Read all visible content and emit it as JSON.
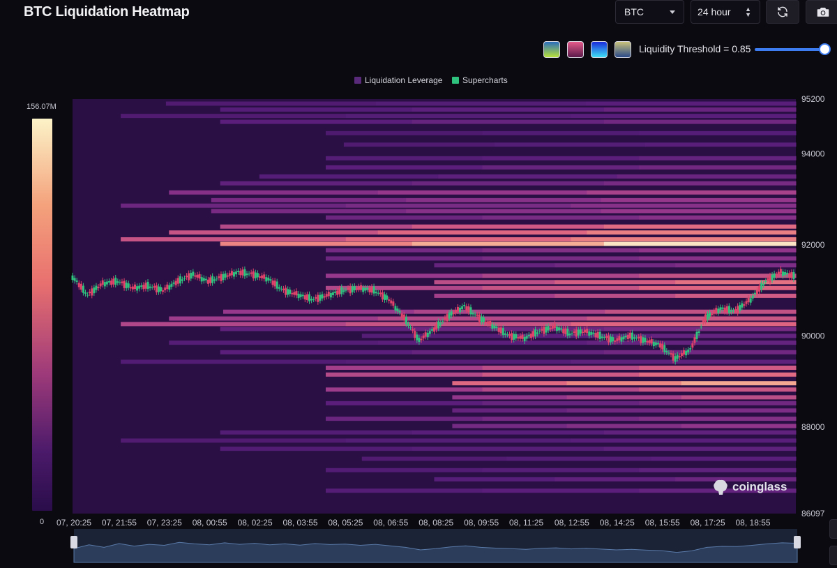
{
  "header": {
    "title": "BTC Liquidation Heatmap",
    "symbol_select": {
      "value": "BTC"
    },
    "time_select": {
      "value": "24 hour"
    }
  },
  "threshold": {
    "label": "Liquidity Threshold = 0.85",
    "value": 0.85,
    "palettes": [
      {
        "name": "viridis",
        "from": "#2b6dbb",
        "to": "#b8e23a"
      },
      {
        "name": "magma",
        "from": "#e35a8a",
        "to": "#5a1a4a"
      },
      {
        "name": "blue-cyan",
        "from": "#1a2ad8",
        "to": "#3fe0f5"
      },
      {
        "name": "cividis",
        "from": "#c9c27a",
        "to": "#2a4a8a"
      }
    ]
  },
  "legend": {
    "items": [
      {
        "label": "Liquidation Leverage",
        "color": "#5a2a7a"
      },
      {
        "label": "Supercharts",
        "color": "#2ec27e"
      }
    ]
  },
  "color_scale": {
    "max_label": "156.07M",
    "min_label": "0"
  },
  "brand": {
    "text": "coinglass"
  },
  "chart_data": {
    "type": "heatmap",
    "title": "BTC Liquidation Heatmap",
    "ylim": [
      86097,
      95200
    ],
    "y_ticks": [
      95200,
      94000,
      92000,
      90000,
      88000,
      86097
    ],
    "x_ticks": [
      "07, 20:25",
      "07, 21:55",
      "07, 23:25",
      "08, 00:55",
      "08, 02:25",
      "08, 03:55",
      "08, 05:25",
      "08, 06:55",
      "08, 08:25",
      "08, 09:55",
      "08, 11:25",
      "08, 12:55",
      "08, 14:25",
      "08, 15:55",
      "08, 17:25",
      "08, 18:55"
    ],
    "x_range_hours": [
      0,
      24
    ],
    "bands": [
      {
        "price": 95100,
        "start": 3.1,
        "intensity": 0.3
      },
      {
        "price": 94970,
        "start": 4.9,
        "intensity": 0.35
      },
      {
        "price": 94830,
        "start": 1.6,
        "intensity": 0.3
      },
      {
        "price": 94700,
        "start": 4.9,
        "intensity": 0.38
      },
      {
        "price": 94450,
        "start": 8.4,
        "intensity": 0.28
      },
      {
        "price": 94200,
        "start": 9.0,
        "intensity": 0.3
      },
      {
        "price": 93900,
        "start": 8.4,
        "intensity": 0.34
      },
      {
        "price": 93700,
        "start": 8.4,
        "intensity": 0.38
      },
      {
        "price": 93500,
        "start": 6.2,
        "intensity": 0.35
      },
      {
        "price": 93350,
        "start": 4.9,
        "intensity": 0.4
      },
      {
        "price": 93150,
        "start": 3.2,
        "intensity": 0.55
      },
      {
        "price": 92980,
        "start": 4.6,
        "intensity": 0.5
      },
      {
        "price": 92860,
        "start": 1.6,
        "intensity": 0.45
      },
      {
        "price": 92740,
        "start": 4.6,
        "intensity": 0.5
      },
      {
        "price": 92600,
        "start": 8.4,
        "intensity": 0.45
      },
      {
        "price": 92400,
        "start": 4.9,
        "intensity": 0.72
      },
      {
        "price": 92270,
        "start": 3.2,
        "intensity": 0.78
      },
      {
        "price": 92120,
        "start": 1.6,
        "intensity": 0.78
      },
      {
        "price": 92020,
        "start": 4.9,
        "intensity": 0.98
      },
      {
        "price": 91880,
        "start": 8.4,
        "intensity": 0.48
      },
      {
        "price": 91700,
        "start": 8.4,
        "intensity": 0.45
      },
      {
        "price": 91550,
        "start": 12.0,
        "intensity": 0.42
      },
      {
        "price": 91320,
        "start": 8.4,
        "intensity": 0.62
      },
      {
        "price": 91180,
        "start": 12.0,
        "intensity": 0.74
      },
      {
        "price": 91050,
        "start": 8.4,
        "intensity": 0.7
      },
      {
        "price": 90880,
        "start": 12.0,
        "intensity": 0.66
      },
      {
        "price": 90530,
        "start": 5.0,
        "intensity": 0.62
      },
      {
        "price": 90380,
        "start": 3.2,
        "intensity": 0.64
      },
      {
        "price": 90260,
        "start": 1.6,
        "intensity": 0.7
      },
      {
        "price": 90150,
        "start": 4.9,
        "intensity": 0.4
      },
      {
        "price": 90000,
        "start": 9.6,
        "intensity": 0.34
      },
      {
        "price": 89850,
        "start": 3.2,
        "intensity": 0.34
      },
      {
        "price": 89640,
        "start": 4.9,
        "intensity": 0.38
      },
      {
        "price": 89430,
        "start": 1.6,
        "intensity": 0.32
      },
      {
        "price": 89300,
        "start": 8.4,
        "intensity": 0.66
      },
      {
        "price": 89150,
        "start": 8.4,
        "intensity": 0.72
      },
      {
        "price": 88960,
        "start": 12.6,
        "intensity": 0.88
      },
      {
        "price": 88820,
        "start": 8.4,
        "intensity": 0.64
      },
      {
        "price": 88650,
        "start": 12.6,
        "intensity": 0.6
      },
      {
        "price": 88520,
        "start": 8.4,
        "intensity": 0.38
      },
      {
        "price": 88360,
        "start": 12.6,
        "intensity": 0.42
      },
      {
        "price": 88180,
        "start": 8.4,
        "intensity": 0.44
      },
      {
        "price": 88020,
        "start": 12.6,
        "intensity": 0.48
      },
      {
        "price": 87880,
        "start": 4.9,
        "intensity": 0.33
      },
      {
        "price": 87700,
        "start": 1.6,
        "intensity": 0.3
      },
      {
        "price": 87520,
        "start": 4.9,
        "intensity": 0.32
      },
      {
        "price": 87300,
        "start": 9.6,
        "intensity": 0.3
      },
      {
        "price": 87050,
        "start": 8.4,
        "intensity": 0.32
      },
      {
        "price": 86850,
        "start": 12.0,
        "intensity": 0.36
      },
      {
        "price": 86600,
        "start": 8.4,
        "intensity": 0.34
      }
    ],
    "price_series": [
      {
        "t": 0.0,
        "p": 91300
      },
      {
        "t": 0.5,
        "p": 90900
      },
      {
        "t": 1.0,
        "p": 91150
      },
      {
        "t": 1.5,
        "p": 91200
      },
      {
        "t": 2.0,
        "p": 91050
      },
      {
        "t": 2.5,
        "p": 91100
      },
      {
        "t": 3.0,
        "p": 91000
      },
      {
        "t": 3.5,
        "p": 91200
      },
      {
        "t": 4.0,
        "p": 91350
      },
      {
        "t": 4.5,
        "p": 91200
      },
      {
        "t": 5.0,
        "p": 91300
      },
      {
        "t": 5.5,
        "p": 91400
      },
      {
        "t": 6.0,
        "p": 91350
      },
      {
        "t": 6.5,
        "p": 91250
      },
      {
        "t": 7.0,
        "p": 91000
      },
      {
        "t": 7.5,
        "p": 90900
      },
      {
        "t": 8.0,
        "p": 90800
      },
      {
        "t": 8.5,
        "p": 90900
      },
      {
        "t": 9.0,
        "p": 91000
      },
      {
        "t": 9.5,
        "p": 91050
      },
      {
        "t": 10.0,
        "p": 91000
      },
      {
        "t": 10.5,
        "p": 90800
      },
      {
        "t": 11.0,
        "p": 90400
      },
      {
        "t": 11.5,
        "p": 89900
      },
      {
        "t": 12.0,
        "p": 90150
      },
      {
        "t": 12.5,
        "p": 90450
      },
      {
        "t": 13.0,
        "p": 90650
      },
      {
        "t": 13.5,
        "p": 90400
      },
      {
        "t": 14.0,
        "p": 90200
      },
      {
        "t": 14.5,
        "p": 90000
      },
      {
        "t": 15.0,
        "p": 89950
      },
      {
        "t": 15.5,
        "p": 90100
      },
      {
        "t": 16.0,
        "p": 90200
      },
      {
        "t": 16.5,
        "p": 90050
      },
      {
        "t": 17.0,
        "p": 90100
      },
      {
        "t": 17.5,
        "p": 90000
      },
      {
        "t": 18.0,
        "p": 89900
      },
      {
        "t": 18.5,
        "p": 90000
      },
      {
        "t": 19.0,
        "p": 89900
      },
      {
        "t": 19.5,
        "p": 89800
      },
      {
        "t": 20.0,
        "p": 89500
      },
      {
        "t": 20.5,
        "p": 89700
      },
      {
        "t": 21.0,
        "p": 90400
      },
      {
        "t": 21.5,
        "p": 90600
      },
      {
        "t": 22.0,
        "p": 90550
      },
      {
        "t": 22.5,
        "p": 90800
      },
      {
        "t": 23.0,
        "p": 91200
      },
      {
        "t": 23.5,
        "p": 91400
      },
      {
        "t": 24.0,
        "p": 91300
      }
    ],
    "navigator_profile": [
      0.55,
      0.7,
      0.6,
      0.75,
      0.65,
      0.72,
      0.68,
      0.8,
      0.74,
      0.7,
      0.78,
      0.72,
      0.76,
      0.7,
      0.74,
      0.69,
      0.75,
      0.71,
      0.73,
      0.68,
      0.72,
      0.66,
      0.6,
      0.5,
      0.55,
      0.62,
      0.66,
      0.6,
      0.57,
      0.55,
      0.52,
      0.56,
      0.58,
      0.54,
      0.56,
      0.53,
      0.5,
      0.52,
      0.49,
      0.47,
      0.4,
      0.46,
      0.6,
      0.64,
      0.63,
      0.68,
      0.74,
      0.78,
      0.76
    ]
  }
}
